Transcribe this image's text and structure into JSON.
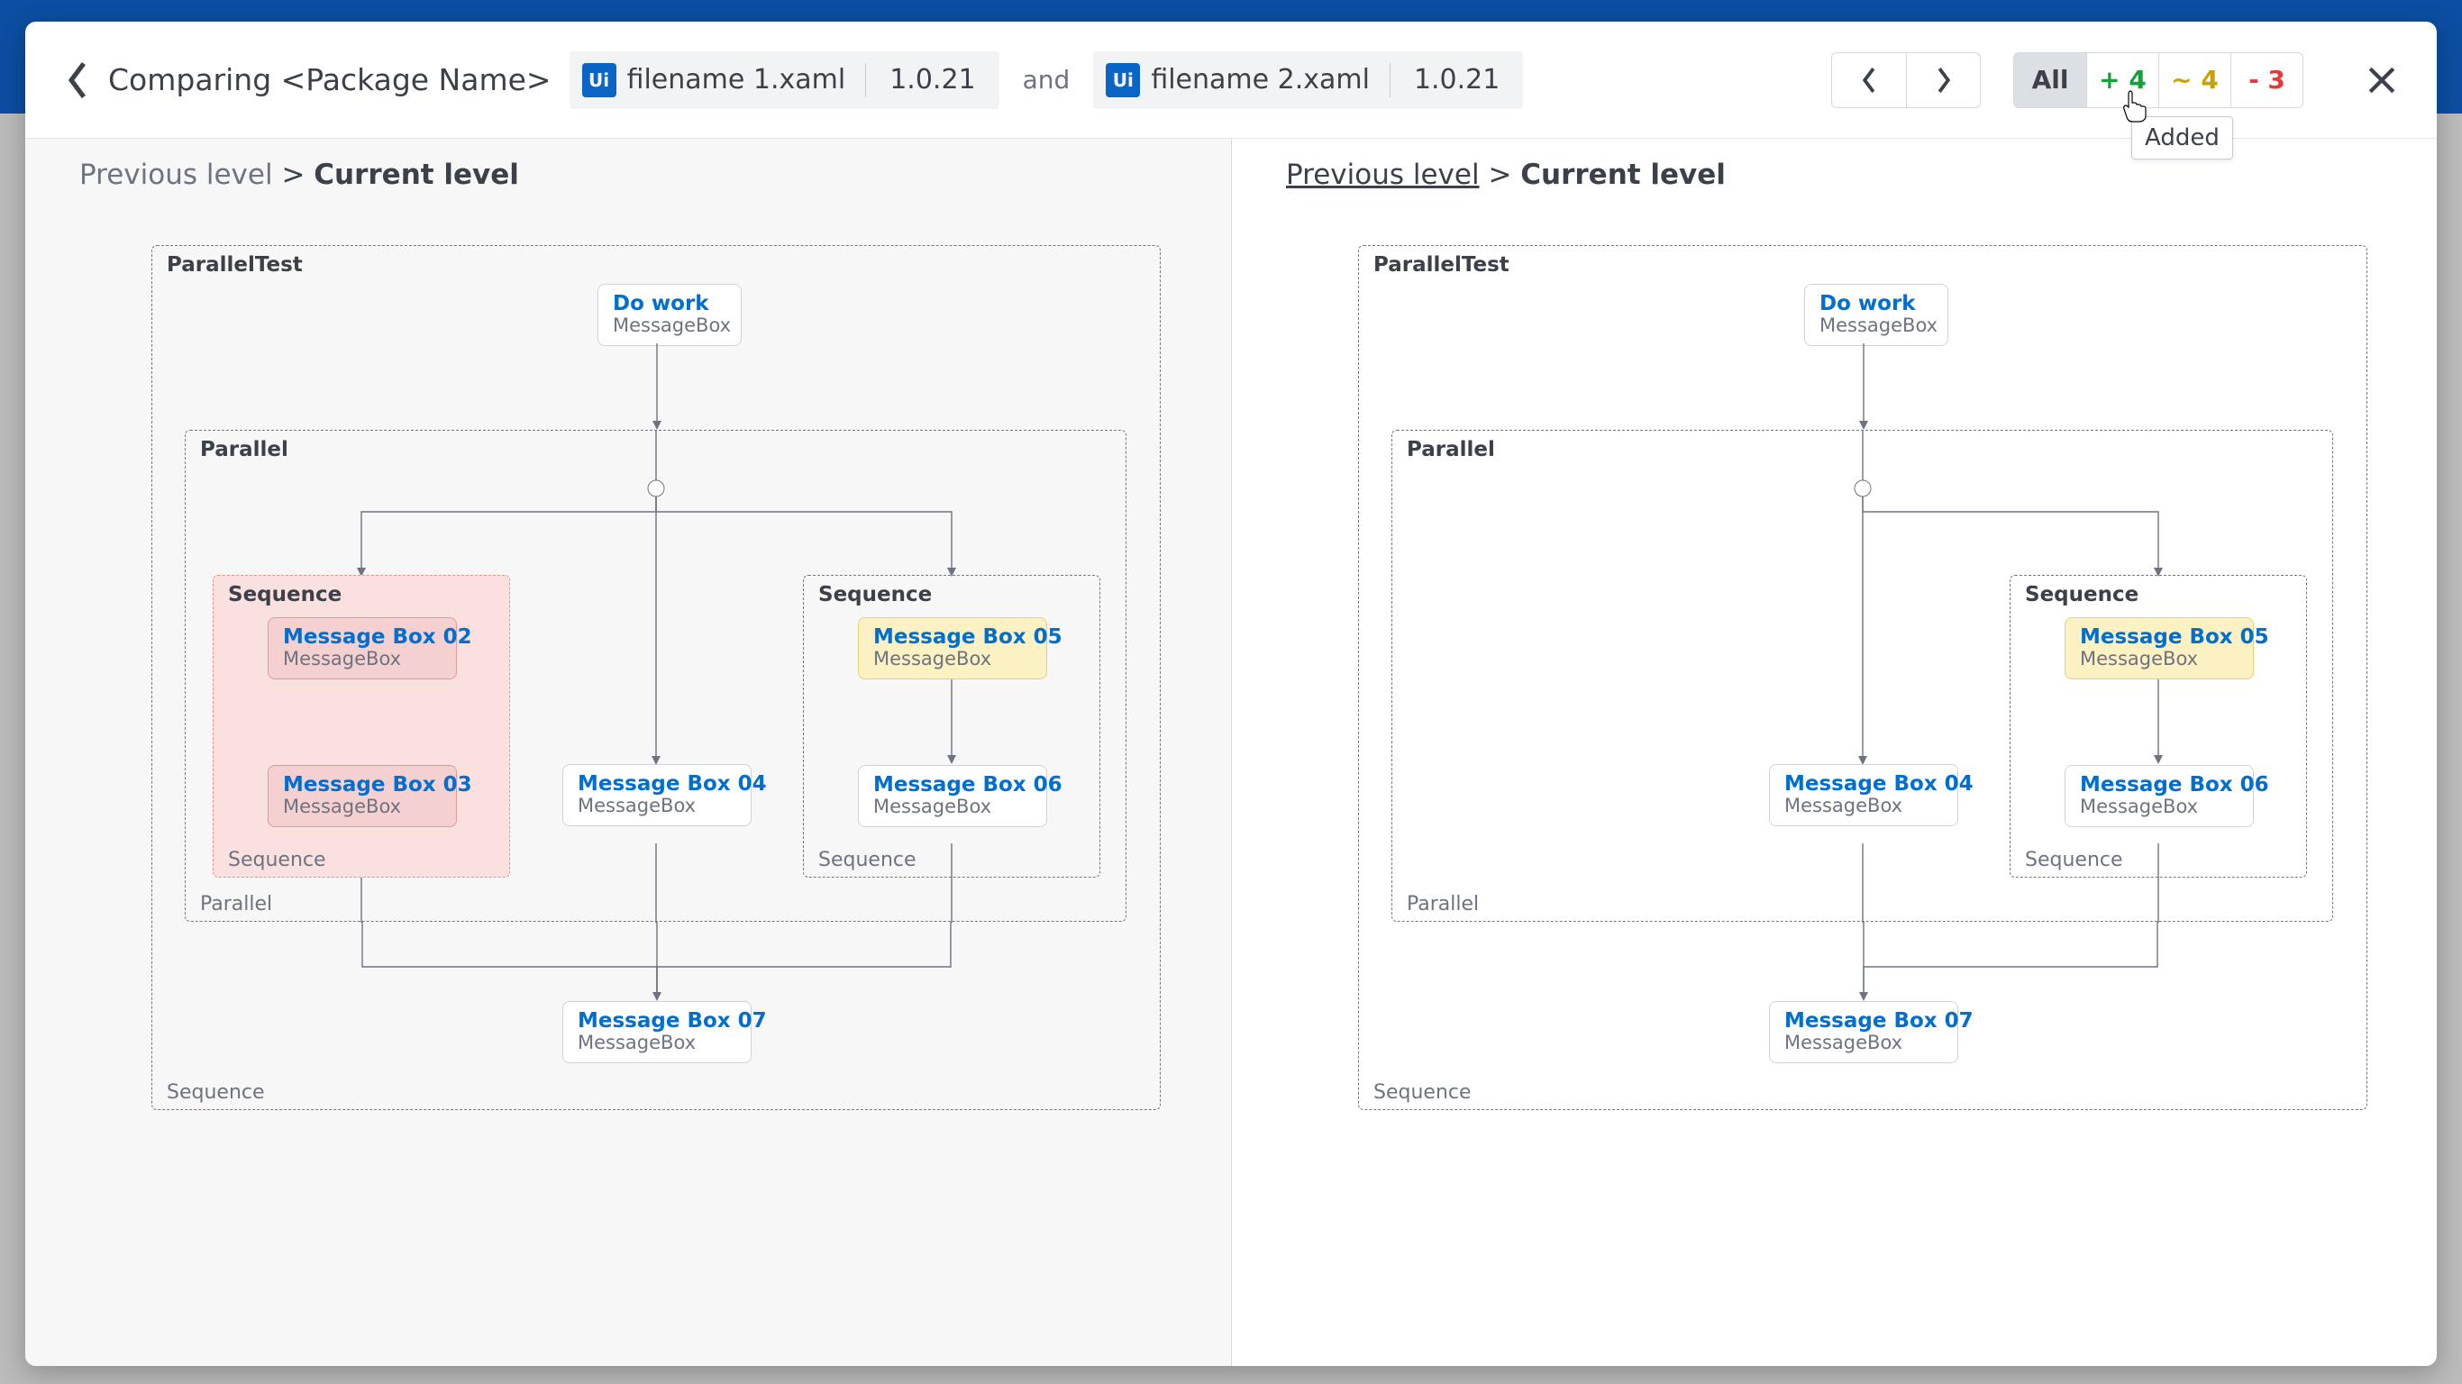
{
  "header": {
    "title": "Comparing <Package Name>",
    "file1": {
      "name": "filename 1.xaml",
      "version": "1.0.21",
      "badge": "Ui"
    },
    "and": "and",
    "file2": {
      "name": "filename 2.xaml",
      "version": "1.0.21",
      "badge": "Ui"
    }
  },
  "filters": {
    "all": "All",
    "added": "+ 4",
    "modified": "~ 4",
    "removed": "- 3"
  },
  "tooltip": {
    "added": "Added"
  },
  "breadcrumb": {
    "previous": "Previous level",
    "sep": ">",
    "current": "Current level"
  },
  "diagram": {
    "container": "ParallelTest",
    "containerBottom": "Sequence",
    "parallel": "Parallel",
    "parallelBottom": "Parallel",
    "sequence": "Sequence",
    "sequenceBottom": "Sequence",
    "doWork": {
      "title": "Do work",
      "sub": "MessageBox"
    },
    "mb02": {
      "title": "Message Box 02",
      "sub": "MessageBox"
    },
    "mb03": {
      "title": "Message Box 03",
      "sub": "MessageBox"
    },
    "mb04": {
      "title": "Message Box 04",
      "sub": "MessageBox"
    },
    "mb05": {
      "title": "Message Box 05",
      "sub": "MessageBox"
    },
    "mb06": {
      "title": "Message Box 06",
      "sub": "MessageBox"
    },
    "mb07": {
      "title": "Message Box 07",
      "sub": "MessageBox"
    }
  }
}
